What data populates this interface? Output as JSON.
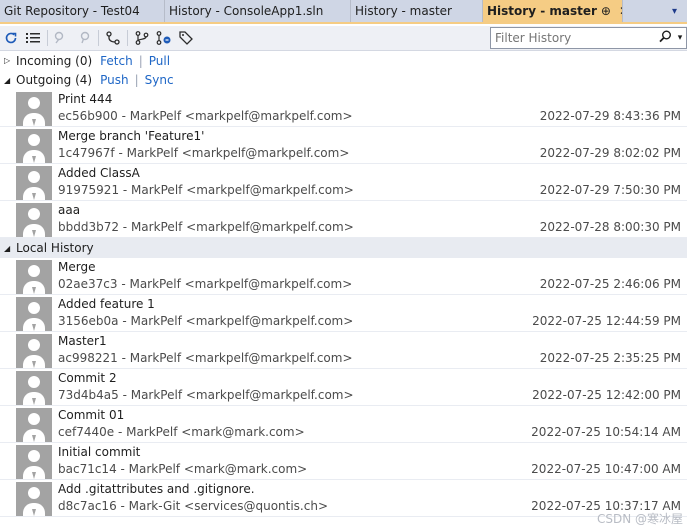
{
  "tabs": [
    {
      "label": "Git Repository - Test04"
    },
    {
      "label": "History - ConsoleApp1.sln"
    },
    {
      "label": "History - master"
    },
    {
      "label": "History - master",
      "pin": "⊕",
      "close": "✕"
    }
  ],
  "tab_overflow_glyph": "▾",
  "toolbar": {
    "filter_placeholder": "Filter History"
  },
  "sections": {
    "incoming": {
      "title": "Incoming (0)",
      "fetch": "Fetch",
      "pull": "Pull",
      "sep": "|"
    },
    "outgoing": {
      "title": "Outgoing (4)",
      "push": "Push",
      "sync": "Sync",
      "sep": "|"
    },
    "local": {
      "title": "Local History"
    }
  },
  "outgoing_commits": [
    {
      "message": "Print 444",
      "meta": "ec56b900 - MarkPelf <markpelf@markpelf.com>",
      "date": "2022-07-29 8:43:36 PM"
    },
    {
      "message": "Merge branch 'Feature1'",
      "meta": "1c47967f - MarkPelf <markpelf@markpelf.com>",
      "date": "2022-07-29 8:02:02 PM"
    },
    {
      "message": "Added ClassA",
      "meta": "91975921 - MarkPelf <markpelf@markpelf.com>",
      "date": "2022-07-29 7:50:30 PM"
    },
    {
      "message": "aaa",
      "meta": "bbdd3b72 - MarkPelf <markpelf@markpelf.com>",
      "date": "2022-07-28 8:00:30 PM"
    }
  ],
  "local_commits": [
    {
      "message": "Merge",
      "meta": "02ae37c3 - MarkPelf <markpelf@markpelf.com>",
      "date": "2022-07-25 2:46:06 PM"
    },
    {
      "message": "Added feature 1",
      "meta": "3156eb0a - MarkPelf <markpelf@markpelf.com>",
      "date": "2022-07-25 12:44:59 PM"
    },
    {
      "message": "Master1",
      "meta": "ac998221 - MarkPelf <markpelf@markpelf.com>",
      "date": "2022-07-25 2:35:25 PM"
    },
    {
      "message": "Commit 2",
      "meta": "73d4b4a5 - MarkPelf <markpelf@markpelf.com>",
      "date": "2022-07-25 12:42:00 PM"
    },
    {
      "message": "Commit 01",
      "meta": "cef7440e - MarkPelf <mark@mark.com>",
      "date": "2022-07-25 10:54:14 AM"
    },
    {
      "message": "Initial commit",
      "meta": "bac71c14 - MarkPelf <mark@mark.com>",
      "date": "2022-07-25 10:47:00 AM"
    },
    {
      "message": "Add .gitattributes and .gitignore.",
      "meta": "d8c7ac16 - Mark-Git <services@quontis.ch>",
      "date": "2022-07-25 10:37:17 AM"
    }
  ],
  "watermark": "CSDN @寒冰屋",
  "colors": {
    "active_tab": "#f5cc84",
    "link": "#1e66c6",
    "avatar": "#a3a3a3"
  }
}
